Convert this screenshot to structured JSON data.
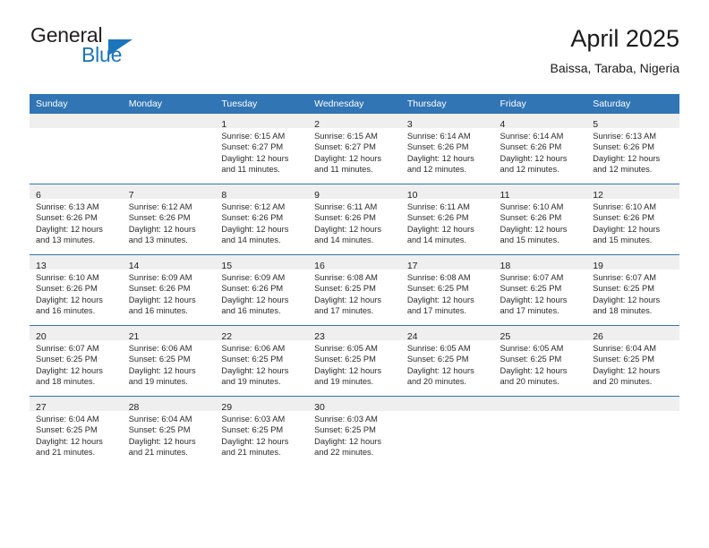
{
  "brand": {
    "name_top": "General",
    "name_bottom": "Blue",
    "accent_color": "#1b75bb"
  },
  "header": {
    "title": "April 2025",
    "subtitle": "Baissa, Taraba, Nigeria"
  },
  "theme": {
    "header_blue": "#3175b4",
    "daynum_band": "#efefef",
    "text": "#2b2b2b"
  },
  "weekdays": [
    "Sunday",
    "Monday",
    "Tuesday",
    "Wednesday",
    "Thursday",
    "Friday",
    "Saturday"
  ],
  "labels": {
    "sunrise_prefix": "Sunrise:",
    "sunset_prefix": "Sunset:",
    "daylight_prefix": "Daylight:"
  },
  "weeks": [
    [
      {
        "day": "",
        "empty": true
      },
      {
        "day": "",
        "empty": true
      },
      {
        "day": "1",
        "sunrise": "Sunrise: 6:15 AM",
        "sunset": "Sunset: 6:27 PM",
        "daylight_1": "Daylight: 12 hours",
        "daylight_2": "and 11 minutes."
      },
      {
        "day": "2",
        "sunrise": "Sunrise: 6:15 AM",
        "sunset": "Sunset: 6:27 PM",
        "daylight_1": "Daylight: 12 hours",
        "daylight_2": "and 11 minutes."
      },
      {
        "day": "3",
        "sunrise": "Sunrise: 6:14 AM",
        "sunset": "Sunset: 6:26 PM",
        "daylight_1": "Daylight: 12 hours",
        "daylight_2": "and 12 minutes."
      },
      {
        "day": "4",
        "sunrise": "Sunrise: 6:14 AM",
        "sunset": "Sunset: 6:26 PM",
        "daylight_1": "Daylight: 12 hours",
        "daylight_2": "and 12 minutes."
      },
      {
        "day": "5",
        "sunrise": "Sunrise: 6:13 AM",
        "sunset": "Sunset: 6:26 PM",
        "daylight_1": "Daylight: 12 hours",
        "daylight_2": "and 12 minutes."
      }
    ],
    [
      {
        "day": "6",
        "sunrise": "Sunrise: 6:13 AM",
        "sunset": "Sunset: 6:26 PM",
        "daylight_1": "Daylight: 12 hours",
        "daylight_2": "and 13 minutes."
      },
      {
        "day": "7",
        "sunrise": "Sunrise: 6:12 AM",
        "sunset": "Sunset: 6:26 PM",
        "daylight_1": "Daylight: 12 hours",
        "daylight_2": "and 13 minutes."
      },
      {
        "day": "8",
        "sunrise": "Sunrise: 6:12 AM",
        "sunset": "Sunset: 6:26 PM",
        "daylight_1": "Daylight: 12 hours",
        "daylight_2": "and 14 minutes."
      },
      {
        "day": "9",
        "sunrise": "Sunrise: 6:11 AM",
        "sunset": "Sunset: 6:26 PM",
        "daylight_1": "Daylight: 12 hours",
        "daylight_2": "and 14 minutes."
      },
      {
        "day": "10",
        "sunrise": "Sunrise: 6:11 AM",
        "sunset": "Sunset: 6:26 PM",
        "daylight_1": "Daylight: 12 hours",
        "daylight_2": "and 14 minutes."
      },
      {
        "day": "11",
        "sunrise": "Sunrise: 6:10 AM",
        "sunset": "Sunset: 6:26 PM",
        "daylight_1": "Daylight: 12 hours",
        "daylight_2": "and 15 minutes."
      },
      {
        "day": "12",
        "sunrise": "Sunrise: 6:10 AM",
        "sunset": "Sunset: 6:26 PM",
        "daylight_1": "Daylight: 12 hours",
        "daylight_2": "and 15 minutes."
      }
    ],
    [
      {
        "day": "13",
        "sunrise": "Sunrise: 6:10 AM",
        "sunset": "Sunset: 6:26 PM",
        "daylight_1": "Daylight: 12 hours",
        "daylight_2": "and 16 minutes."
      },
      {
        "day": "14",
        "sunrise": "Sunrise: 6:09 AM",
        "sunset": "Sunset: 6:26 PM",
        "daylight_1": "Daylight: 12 hours",
        "daylight_2": "and 16 minutes."
      },
      {
        "day": "15",
        "sunrise": "Sunrise: 6:09 AM",
        "sunset": "Sunset: 6:26 PM",
        "daylight_1": "Daylight: 12 hours",
        "daylight_2": "and 16 minutes."
      },
      {
        "day": "16",
        "sunrise": "Sunrise: 6:08 AM",
        "sunset": "Sunset: 6:25 PM",
        "daylight_1": "Daylight: 12 hours",
        "daylight_2": "and 17 minutes."
      },
      {
        "day": "17",
        "sunrise": "Sunrise: 6:08 AM",
        "sunset": "Sunset: 6:25 PM",
        "daylight_1": "Daylight: 12 hours",
        "daylight_2": "and 17 minutes."
      },
      {
        "day": "18",
        "sunrise": "Sunrise: 6:07 AM",
        "sunset": "Sunset: 6:25 PM",
        "daylight_1": "Daylight: 12 hours",
        "daylight_2": "and 17 minutes."
      },
      {
        "day": "19",
        "sunrise": "Sunrise: 6:07 AM",
        "sunset": "Sunset: 6:25 PM",
        "daylight_1": "Daylight: 12 hours",
        "daylight_2": "and 18 minutes."
      }
    ],
    [
      {
        "day": "20",
        "sunrise": "Sunrise: 6:07 AM",
        "sunset": "Sunset: 6:25 PM",
        "daylight_1": "Daylight: 12 hours",
        "daylight_2": "and 18 minutes."
      },
      {
        "day": "21",
        "sunrise": "Sunrise: 6:06 AM",
        "sunset": "Sunset: 6:25 PM",
        "daylight_1": "Daylight: 12 hours",
        "daylight_2": "and 19 minutes."
      },
      {
        "day": "22",
        "sunrise": "Sunrise: 6:06 AM",
        "sunset": "Sunset: 6:25 PM",
        "daylight_1": "Daylight: 12 hours",
        "daylight_2": "and 19 minutes."
      },
      {
        "day": "23",
        "sunrise": "Sunrise: 6:05 AM",
        "sunset": "Sunset: 6:25 PM",
        "daylight_1": "Daylight: 12 hours",
        "daylight_2": "and 19 minutes."
      },
      {
        "day": "24",
        "sunrise": "Sunrise: 6:05 AM",
        "sunset": "Sunset: 6:25 PM",
        "daylight_1": "Daylight: 12 hours",
        "daylight_2": "and 20 minutes."
      },
      {
        "day": "25",
        "sunrise": "Sunrise: 6:05 AM",
        "sunset": "Sunset: 6:25 PM",
        "daylight_1": "Daylight: 12 hours",
        "daylight_2": "and 20 minutes."
      },
      {
        "day": "26",
        "sunrise": "Sunrise: 6:04 AM",
        "sunset": "Sunset: 6:25 PM",
        "daylight_1": "Daylight: 12 hours",
        "daylight_2": "and 20 minutes."
      }
    ],
    [
      {
        "day": "27",
        "sunrise": "Sunrise: 6:04 AM",
        "sunset": "Sunset: 6:25 PM",
        "daylight_1": "Daylight: 12 hours",
        "daylight_2": "and 21 minutes."
      },
      {
        "day": "28",
        "sunrise": "Sunrise: 6:04 AM",
        "sunset": "Sunset: 6:25 PM",
        "daylight_1": "Daylight: 12 hours",
        "daylight_2": "and 21 minutes."
      },
      {
        "day": "29",
        "sunrise": "Sunrise: 6:03 AM",
        "sunset": "Sunset: 6:25 PM",
        "daylight_1": "Daylight: 12 hours",
        "daylight_2": "and 21 minutes."
      },
      {
        "day": "30",
        "sunrise": "Sunrise: 6:03 AM",
        "sunset": "Sunset: 6:25 PM",
        "daylight_1": "Daylight: 12 hours",
        "daylight_2": "and 22 minutes."
      },
      {
        "day": "",
        "empty": true
      },
      {
        "day": "",
        "empty": true
      },
      {
        "day": "",
        "empty": true
      }
    ]
  ]
}
